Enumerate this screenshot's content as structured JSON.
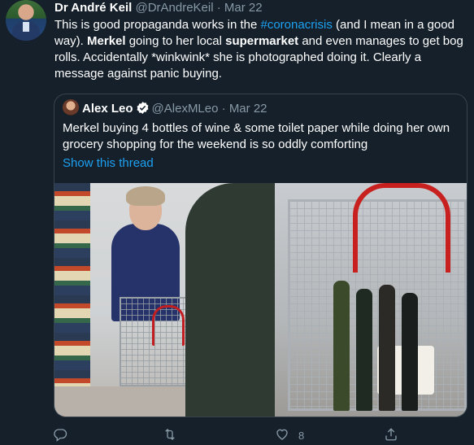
{
  "tweet": {
    "author_name": "Dr André Keil",
    "author_handle": "@DrAndreKeil",
    "separator": "·",
    "date": "Mar 22",
    "text_parts": {
      "p1": "This is good propaganda works in the ",
      "hashtag": "#coronacrisis",
      "p2": " (and I mean in a good way). ",
      "bold1": "Merkel",
      "p3": " going to her local ",
      "bold2": "supermarket",
      "p4": " and even manages to get bog rolls. Accidentally *winkwink* she is photographed doing it. Clearly a message against panic buying."
    }
  },
  "quoted": {
    "author_name": "Alex Leo",
    "author_handle": "@AlexMLeo",
    "separator": "·",
    "date": "Mar 22",
    "text": "Merkel buying 4 bottles of wine &  some toilet paper while doing her own grocery shopping for the weekend is so oddly comforting",
    "show_thread": "Show this thread"
  },
  "actions": {
    "reply_icon": "reply-icon",
    "retweet_icon": "retweet-icon",
    "like_icon": "heart-icon",
    "like_count": "8",
    "share_icon": "share-icon"
  },
  "colors": {
    "background": "#15202b",
    "link": "#1da1f2",
    "muted": "#8899a6",
    "border": "#38444d"
  }
}
